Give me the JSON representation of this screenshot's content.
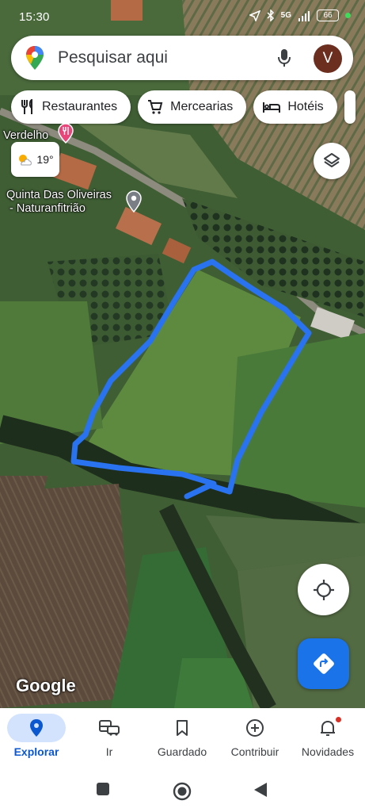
{
  "status_bar": {
    "time": "15:30",
    "network": "5G",
    "battery": "66"
  },
  "search": {
    "placeholder": "Pesquisar aqui",
    "avatar_initial": "V"
  },
  "chips": [
    {
      "label": "Restaurantes",
      "icon": "fork-knife-icon"
    },
    {
      "label": "Mercearias",
      "icon": "shopping-cart-icon"
    },
    {
      "label": "Hotéis",
      "icon": "bed-icon"
    }
  ],
  "weather": {
    "temperature": "19°",
    "icon": "partly-sunny-icon"
  },
  "places": {
    "verdelho": "Verdelho",
    "quinta_line1": "Quinta Das Oliveiras",
    "quinta_line2": "- Naturanfitrião"
  },
  "map": {
    "attribution": "Google",
    "drawing_color": "#2a73f0"
  },
  "bottom_nav": [
    {
      "label": "Explorar",
      "icon": "location-pin-icon",
      "active": true
    },
    {
      "label": "Ir",
      "icon": "commute-icon",
      "active": false
    },
    {
      "label": "Guardado",
      "icon": "bookmark-icon",
      "active": false
    },
    {
      "label": "Contribuir",
      "icon": "add-circle-icon",
      "active": false
    },
    {
      "label": "Novidades",
      "icon": "bell-icon",
      "active": false
    }
  ],
  "colors": {
    "accent": "#1a73e8",
    "active_nav_bg": "#d3e3fd",
    "notification_dot": "#d93025"
  }
}
